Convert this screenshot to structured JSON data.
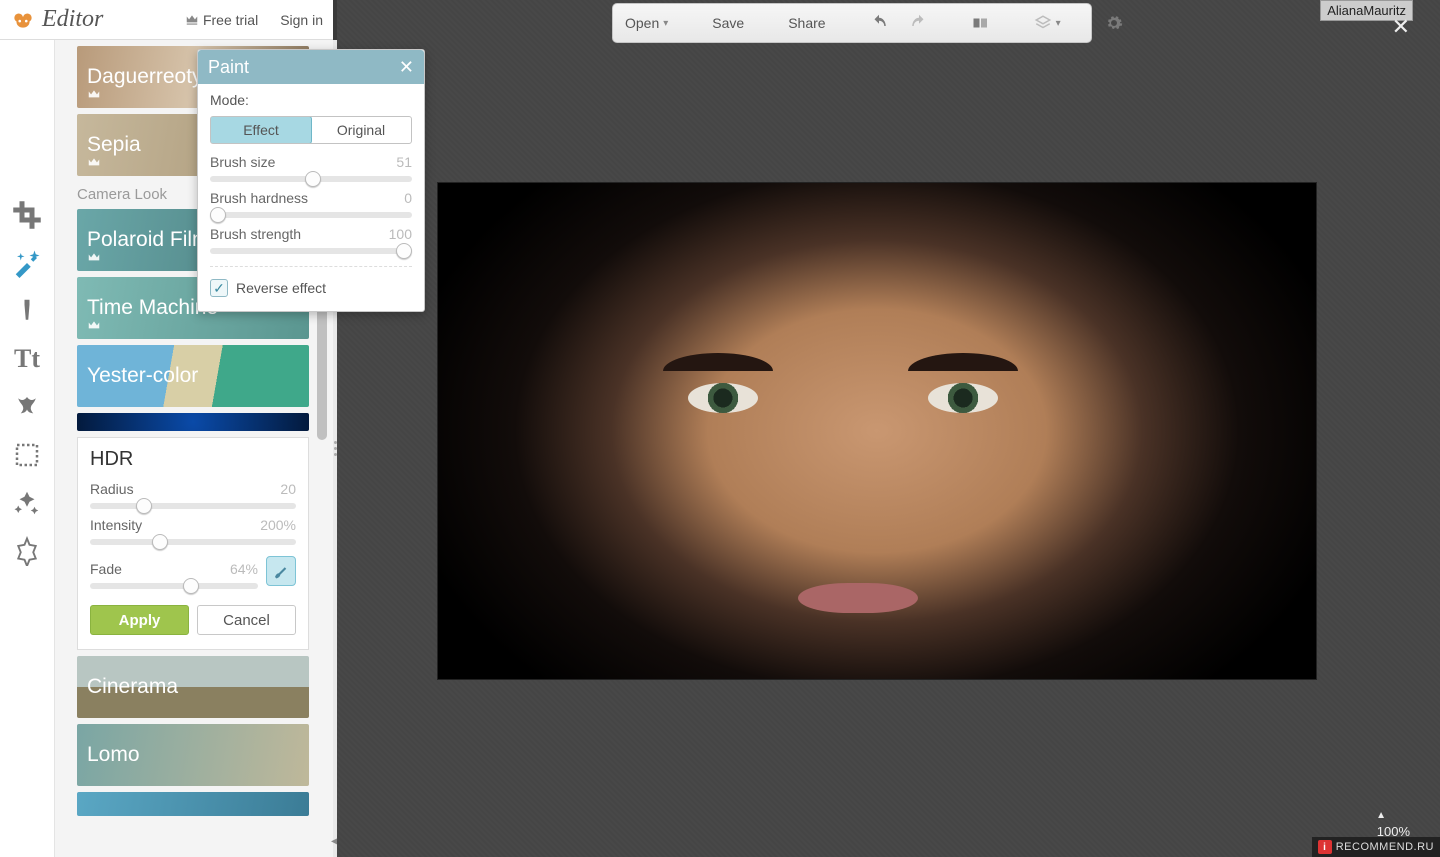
{
  "header": {
    "app_name": "Editor",
    "free_trial": "Free trial",
    "sign_in": "Sign in"
  },
  "toolbar": {
    "open": "Open",
    "save": "Save",
    "share": "Share"
  },
  "effects": {
    "section_label": "Camera Look",
    "tiles": {
      "daguerreotype": "Daguerreotype",
      "sepia": "Sepia",
      "polaroid": "Polaroid Film",
      "time_machine": "Time Machine",
      "yester": "Yester-color",
      "cinerama": "Cinerama",
      "lomo": "Lomo"
    }
  },
  "hdr": {
    "title": "HDR",
    "radius_label": "Radius",
    "radius_value": "20",
    "intensity_label": "Intensity",
    "intensity_value": "200%",
    "fade_label": "Fade",
    "fade_value": "64%",
    "apply": "Apply",
    "cancel": "Cancel"
  },
  "paint": {
    "title": "Paint",
    "mode_label": "Mode:",
    "effect": "Effect",
    "original": "Original",
    "brush_size_label": "Brush size",
    "brush_size_value": "51",
    "brush_hardness_label": "Brush hardness",
    "brush_hardness_value": "0",
    "brush_strength_label": "Brush strength",
    "brush_strength_value": "100",
    "reverse": "Reverse effect"
  },
  "overlay": {
    "username": "AlianaMauritz",
    "zoom": "100%",
    "recommend": "RECOMMEND.RU"
  }
}
